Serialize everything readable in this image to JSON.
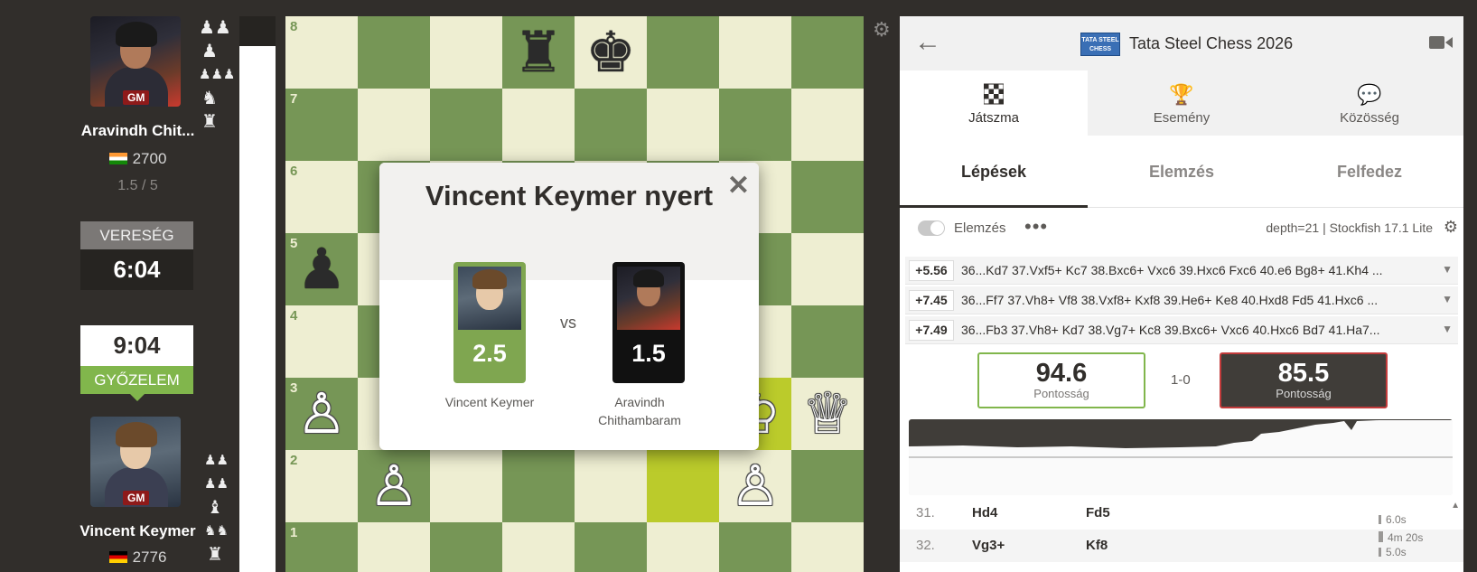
{
  "players": {
    "top": {
      "name": "Aravindh Chit...",
      "title": "GM",
      "rating": "2700",
      "score": "1.5 / 5",
      "result_label": "VERESÉG",
      "clock": "6:04",
      "captured": [
        "♟♟",
        "♟",
        "♟♟♟",
        "♞",
        "♜"
      ]
    },
    "bottom": {
      "name": "Vincent Keymer",
      "title": "GM",
      "rating": "2776",
      "result_label": "GYŐZELEM",
      "clock": "9:04",
      "captured": [
        "♟♟",
        "♟♟",
        "♝",
        "♞♞",
        "♜"
      ]
    }
  },
  "board": {
    "ranks": [
      "8",
      "7",
      "6",
      "5",
      "4",
      "3",
      "2",
      "1"
    ],
    "pieces": [
      {
        "sq": "d8",
        "glyph": "♜",
        "color": "black"
      },
      {
        "sq": "e8",
        "glyph": "♚",
        "color": "black"
      },
      {
        "sq": "a5",
        "glyph": "♟",
        "color": "black"
      },
      {
        "sq": "a3",
        "glyph": "♙",
        "color": "white"
      },
      {
        "sq": "g3",
        "glyph": "♔",
        "color": "white"
      },
      {
        "sq": "h3",
        "glyph": "♕",
        "color": "white"
      },
      {
        "sq": "b2",
        "glyph": "♙",
        "color": "white"
      },
      {
        "sq": "g2",
        "glyph": "♙",
        "color": "white"
      }
    ],
    "highlighted": [
      "f2",
      "g3"
    ]
  },
  "modal": {
    "title": "Vincent Keymer nyert",
    "vs": "vs",
    "winner": {
      "name": "Vincent Keymer",
      "score": "2.5"
    },
    "loser": {
      "name": "Aravindh Chithambaram",
      "score": "1.5"
    }
  },
  "panel": {
    "event_title": "Tata Steel Chess 2026",
    "event_logo_text": "TATA STEEL CHESS",
    "tabs": [
      {
        "label": "Játszma",
        "icon": "board-icon"
      },
      {
        "label": "Esemény",
        "icon": "trophy-icon"
      },
      {
        "label": "Közösség",
        "icon": "chat-icon"
      }
    ],
    "subtabs": [
      "Lépések",
      "Elemzés",
      "Felfedez"
    ],
    "analysis_label": "Elemzés",
    "engine_info": "depth=21 | Stockfish 17.1 Lite",
    "lines": [
      {
        "eval": "+5.56",
        "moves": "36...Kd7 37.Vxf5+ Kc7 38.Bxc6+ Vxc6 39.Hxc6 Fxc6 40.e6 Bg8+ 41.Kh4 ..."
      },
      {
        "eval": "+7.45",
        "moves": "36...Ff7 37.Vh8+ Vf8 38.Vxf8+ Kxf8 39.He6+ Ke8 40.Hxd8 Fd5 41.Hxc6 ..."
      },
      {
        "eval": "+7.49",
        "moves": "36...Fb3 37.Vh8+ Kd7 38.Vg7+ Kc8 39.Bxc6+ Vxc6 40.Hxc6 Bd7 41.Ha7..."
      }
    ],
    "accuracy": {
      "white": {
        "value": "94.6",
        "label": "Pontosság"
      },
      "black": {
        "value": "85.5",
        "label": "Pontosság"
      },
      "score": "1-0"
    },
    "moves": [
      {
        "num": "31.",
        "white": "Hd4",
        "black": "Fd5",
        "t1": "",
        "t2": "6.0s"
      },
      {
        "num": "32.",
        "white": "Vg3+",
        "black": "Kf8",
        "t1": "4m 20s",
        "t2": "5.0s"
      }
    ]
  },
  "colors": {
    "board_light": "#eeeed2",
    "board_dark": "#769656",
    "win_green": "#81b64c",
    "loss_red": "#c23b3b",
    "background": "#312e2b"
  }
}
